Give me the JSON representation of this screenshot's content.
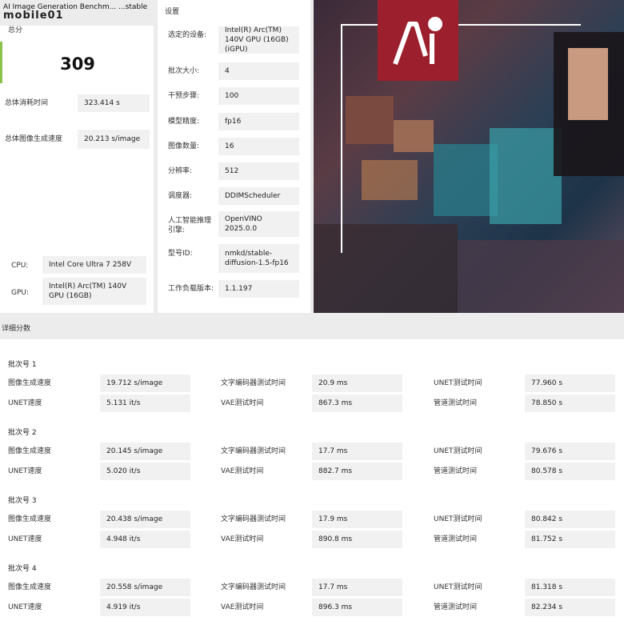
{
  "header": {
    "logo": "mobile01",
    "title": "AI Image Generation Benchm... ...stable"
  },
  "summary": {
    "total_label": "总分",
    "score": "309",
    "total_time_label": "总体消耗时间",
    "total_time_value": "323.414 s",
    "speed_label": "总体图像生成速度",
    "speed_value": "20.213 s/image",
    "cpu_label": "CPU:",
    "cpu_value": "Intel Core Ultra 7 258V",
    "gpu_label": "GPU:",
    "gpu_value": "Intel(R) Arc(TM) 140V GPU (16GB)"
  },
  "settings": {
    "heading": "设置",
    "rows": [
      {
        "label": "选定的设备:",
        "value": "Intel(R) Arc(TM) 140V GPU (16GB) (iGPU)"
      },
      {
        "label": "批次大小:",
        "value": "4"
      },
      {
        "label": "干预步骤:",
        "value": "100"
      },
      {
        "label": "模型精度:",
        "value": "fp16"
      },
      {
        "label": "图像数量:",
        "value": "16"
      },
      {
        "label": "分辨率:",
        "value": "512"
      },
      {
        "label": "调度器:",
        "value": "DDIMScheduler"
      },
      {
        "label": "人工智能推理引擎:",
        "value": "OpenVINO 2025.0.0"
      },
      {
        "label": "型号ID:",
        "value": "nmkd/stable-diffusion-1.5-fp16"
      },
      {
        "label": "工作负载版本:",
        "value": "1.1.197"
      }
    ]
  },
  "details": {
    "heading": "详细分数",
    "batches": [
      {
        "title": "批次号 1",
        "img_speed": "19.712 s/image",
        "text_enc": "20.9 ms",
        "unet_time": "77.960 s",
        "unet_speed": "5.131 it/s",
        "vae_time": "867.3 ms",
        "pipeline": "78.850 s"
      },
      {
        "title": "批次号 2",
        "img_speed": "20.145 s/image",
        "text_enc": "17.7 ms",
        "unet_time": "79.676 s",
        "unet_speed": "5.020 it/s",
        "vae_time": "882.7 ms",
        "pipeline": "80.578 s"
      },
      {
        "title": "批次号 3",
        "img_speed": "20.438 s/image",
        "text_enc": "17.9 ms",
        "unet_time": "80.842 s",
        "unet_speed": "4.948 it/s",
        "vae_time": "890.8 ms",
        "pipeline": "81.752 s"
      },
      {
        "title": "批次号 4",
        "img_speed": "20.558 s/image",
        "text_enc": "17.7 ms",
        "unet_time": "81.318 s",
        "unet_speed": "4.919 it/s",
        "vae_time": "896.3 ms",
        "pipeline": "82.234 s"
      }
    ],
    "labels": {
      "img_speed": "图像生成速度",
      "text_enc": "文字编码器测试时间",
      "unet_time": "UNET测试时间",
      "unet_speed": "UNET速度",
      "vae_time": "VAE测试时间",
      "pipeline": "管道测试时间"
    }
  },
  "colors": {
    "accent_green": "#8bc34a",
    "logo_red": "#9c1f2d"
  }
}
